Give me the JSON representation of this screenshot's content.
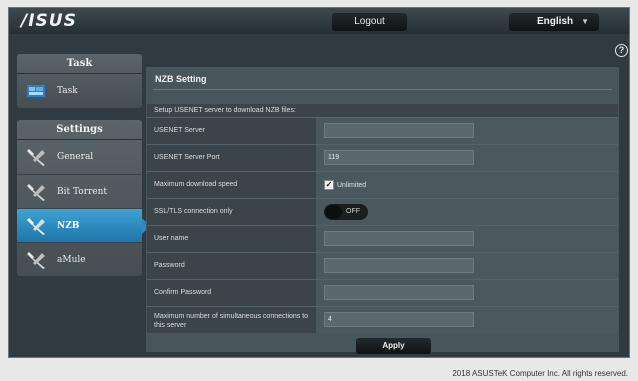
{
  "header": {
    "logo": "/ISUS",
    "logout_label": "Logout",
    "language_label": "English",
    "language_caret": "▼",
    "help_glyph": "?"
  },
  "sidebar": {
    "task_title": "Task",
    "task_item": "Task",
    "settings_title": "Settings",
    "items": [
      {
        "label": "General",
        "icon": "wrench-icon"
      },
      {
        "label": "Bit Torrent",
        "icon": "wrench-icon"
      },
      {
        "label": "NZB",
        "icon": "wrench-icon",
        "active": true
      },
      {
        "label": "aMule",
        "icon": "wrench-icon"
      }
    ]
  },
  "content": {
    "title": "NZB Setting",
    "description": "Setup USENET server to download NZB files:",
    "fields": {
      "usenet_server": {
        "label": "USENET Server",
        "value": ""
      },
      "usenet_server_port": {
        "label": "USENET Server Port",
        "value": "119"
      },
      "max_download_speed": {
        "label": "Maximum download speed",
        "checkbox_label": "Unlimited",
        "checked": true
      },
      "ssl_tls": {
        "label": "SSL/TLS connection only",
        "toggle_label": "OFF"
      },
      "user_name": {
        "label": "User name",
        "value": ""
      },
      "password": {
        "label": "Password",
        "value": ""
      },
      "confirm_password": {
        "label": "Confirm Password",
        "value": ""
      },
      "max_connections": {
        "label": "Maximum number of simultaneous connections to this server",
        "value": "4"
      }
    },
    "apply_label": "Apply"
  },
  "footer": {
    "copyright": "2018 ASUSTeK Computer Inc. All rights reserved."
  },
  "colors": {
    "active_item": "#2b8bbe",
    "frame_bg": "#2f3b40"
  }
}
